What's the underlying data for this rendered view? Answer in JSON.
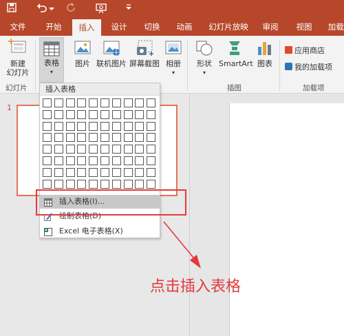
{
  "titlebar": {
    "icons": [
      "save-icon",
      "undo-icon",
      "undo-dropdown-icon",
      "redo-icon",
      "start-slideshow-icon",
      "customize-qat-icon"
    ]
  },
  "tabs": [
    "文件",
    "开始",
    "插入",
    "设计",
    "切换",
    "动画",
    "幻灯片放映",
    "审阅",
    "视图",
    "加载项"
  ],
  "active_tab": "插入",
  "ribbon": {
    "new_slide": "新建\n幻灯片",
    "new_slide_line1": "新建",
    "new_slide_line2": "幻灯片",
    "table": "表格",
    "picture": "图片",
    "online_picture": "联机图片",
    "screenshot": "屏幕截图",
    "album": "相册",
    "shapes": "形状",
    "smartart": "SmartArt",
    "chart": "图表",
    "store": "应用商店",
    "my_addins": "我的加载项",
    "group_slides": "幻灯片",
    "group_illustrations": "插图",
    "group_addins": "加载项"
  },
  "slide_number": "1",
  "dropdown": {
    "title": "插入表格",
    "grid_cols": 10,
    "grid_rows": 8,
    "items": [
      {
        "label": "插入表格(I)...",
        "highlighted": true
      },
      {
        "label": "绘制表格(D)",
        "highlighted": false
      },
      {
        "label": "Excel 电子表格(X)",
        "highlighted": false
      }
    ]
  },
  "annotation": "点击插入表格",
  "colors": {
    "accent": "#b7472a",
    "annotation": "#e4393c"
  }
}
